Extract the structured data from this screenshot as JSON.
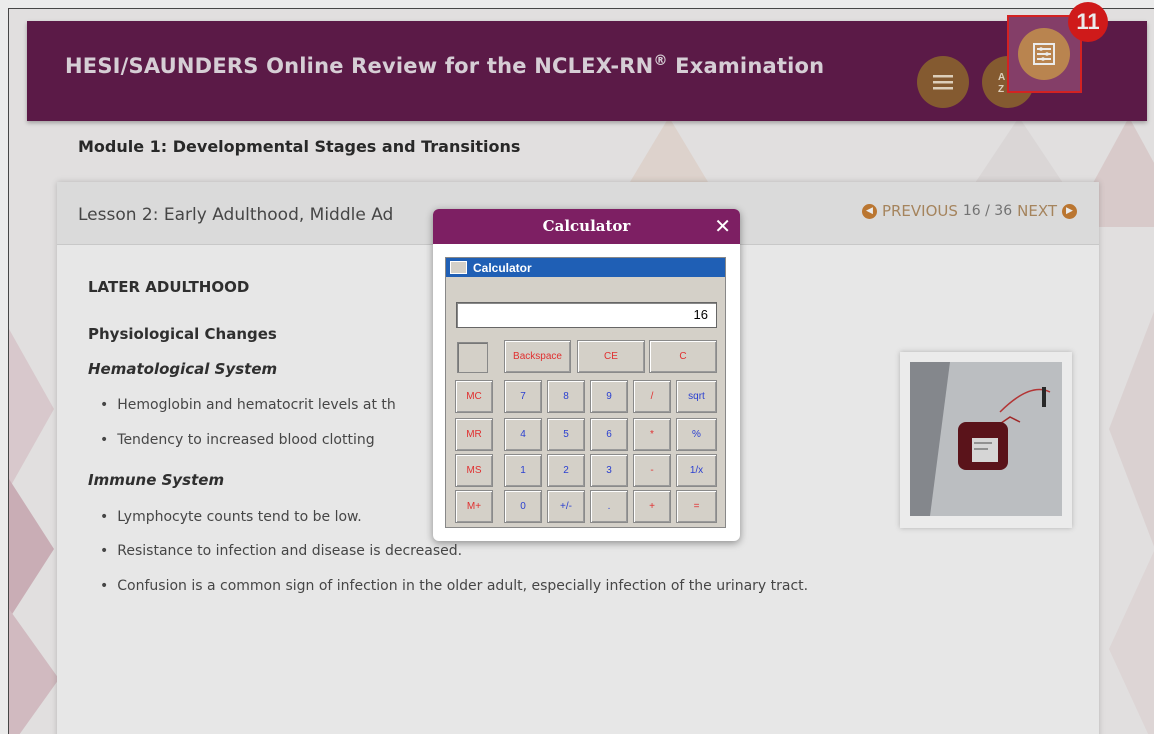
{
  "header": {
    "title": "HESI/SAUNDERS Online Review for the NCLEX-RN",
    "title_reg": "®",
    "title_suffix": " Examination",
    "menu_icon": "hamburger-menu-icon",
    "sort_icon": "sort-az-icon",
    "calc_icon": "abacus-calculator-icon",
    "badge": "11",
    "bg_color": "#5c1245",
    "badge_color": "#e01212"
  },
  "module": {
    "title": "Module 1: Developmental Stages and Transitions"
  },
  "lesson": {
    "title": "Lesson 2: Early Adulthood, Middle Ad",
    "prev_label": "PREVIOUS",
    "page": "16 / 36",
    "next_label": "NEXT"
  },
  "content": {
    "section": "LATER ADULTHOOD",
    "subsection": "Physiological Changes",
    "systems": [
      {
        "name": "Hematological System",
        "bullets": [
          "Hemoglobin and hematocrit levels at th",
          "Tendency to increased blood clotting"
        ]
      },
      {
        "name": "Immune System",
        "bullets": [
          "Lymphocyte counts tend to be low.",
          "Resistance to infection and disease is decreased.",
          "Confusion is a common sign of infection in the older adult, especially infection of the urinary tract."
        ]
      }
    ]
  },
  "dialog": {
    "title": "Calculator",
    "close": "✕",
    "window_title": "Calculator",
    "display": "16",
    "buttons": {
      "backspace": "Backspace",
      "ce": "CE",
      "c": "C",
      "mc": "MC",
      "mr": "MR",
      "ms": "MS",
      "mplus": "M+",
      "n7": "7",
      "n8": "8",
      "n9": "9",
      "div": "/",
      "sqrt": "sqrt",
      "n4": "4",
      "n5": "5",
      "n6": "6",
      "mul": "*",
      "pct": "%",
      "n1": "1",
      "n2": "2",
      "n3": "3",
      "sub": "-",
      "inv": "1/x",
      "n0": "0",
      "sign": "+/-",
      "dot": ".",
      "add": "+",
      "eq": "="
    }
  }
}
